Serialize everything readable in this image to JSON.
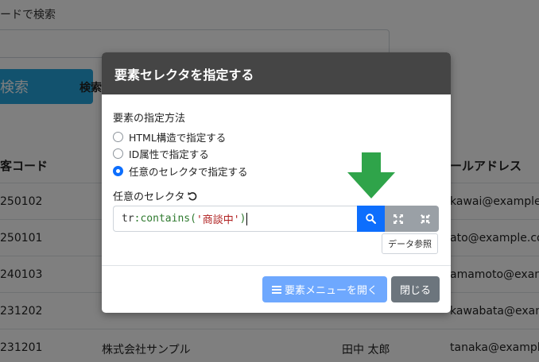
{
  "background": {
    "search_label": "ードで検索",
    "search_button": "検索",
    "search_link": "検索",
    "table": {
      "headers": {
        "code": "客コード",
        "email": "ールアドレス"
      },
      "rows": [
        {
          "code": "250102",
          "company": "",
          "person": "",
          "email": "kawai@example."
        },
        {
          "code": "250101",
          "company": "",
          "person": "",
          "email": "ato@example.co"
        },
        {
          "code": "240103",
          "company": "",
          "person": "",
          "email": "amamoto@exan"
        },
        {
          "code": "231202",
          "company": "",
          "person": "",
          "email": "kawabata@examp"
        },
        {
          "code": "231201",
          "company": "株式会社サンプル",
          "person": "田中 太郎",
          "email": "tanaka@example"
        }
      ]
    }
  },
  "modal": {
    "title": "要素セレクタを指定する",
    "method_title": "要素の指定方法",
    "options": [
      {
        "label": "HTML構造で指定する",
        "checked": false
      },
      {
        "label": "ID属性で指定する",
        "checked": false
      },
      {
        "label": "任意のセレクタで指定する",
        "checked": true
      }
    ],
    "selector_label": "任意のセレクタ",
    "selector_value": {
      "prefix": "tr",
      "func": ":contains(",
      "str": "'商談中'",
      "suffix": ")"
    },
    "data_ref_button": "データ参照",
    "open_menu_button": "要素メニューを開く",
    "close_button": "閉じる"
  },
  "colors": {
    "primary": "#0d6efd",
    "primary_light": "#6ea8fe",
    "secondary": "#6c757d",
    "header": "#454545",
    "arrow": "#2fa44a"
  }
}
